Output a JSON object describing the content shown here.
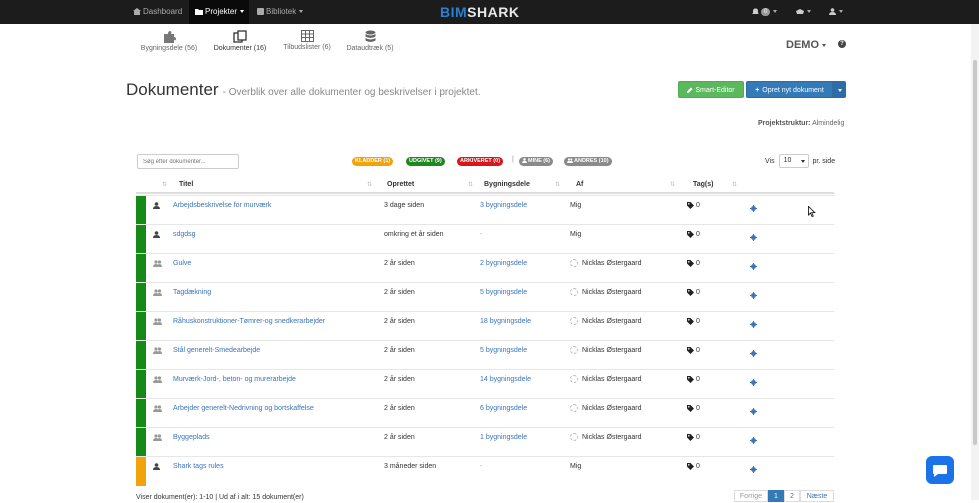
{
  "navbar": {
    "dashboard": "Dashboard",
    "projects": "Projekter",
    "library": "Bibliotek",
    "logo_a": "BIM",
    "logo_b": "SHARK",
    "notification_count": "0"
  },
  "subnav": {
    "tabs": [
      {
        "label": "Bygningsdele (56)",
        "icon": "puzzle-icon"
      },
      {
        "label": "Dokumenter (16)",
        "icon": "documents-icon"
      },
      {
        "label": "Tilbudslister (6)",
        "icon": "table-icon"
      },
      {
        "label": "Dataudtræk (5)",
        "icon": "database-icon"
      }
    ],
    "project_name": "DEMO",
    "help": "?"
  },
  "header": {
    "title": "Dokumenter",
    "subtitle": "- Overblik over alle dokumenter og beskrivelser i projektet.",
    "smart_editor": "Smart-Editor",
    "create_document": "Opret nyt dokument",
    "structure_label": "Projektstruktur:",
    "structure_value": "Almindelig"
  },
  "toolbar": {
    "search_placeholder": "Søg efter dokumenter...",
    "filters": [
      {
        "label": "KLADDER (1)",
        "color": "#f0a30a"
      },
      {
        "label": "UDGIVET (9)",
        "color": "#1e8a1e"
      },
      {
        "label": "ARKIVERET (0)",
        "color": "#d9161c"
      },
      {
        "label": "MINE (6)",
        "color": "#8a8a8a"
      },
      {
        "label": "ANDRES (10)",
        "color": "#8a8a8a"
      }
    ],
    "show_label": "Vis",
    "per_page_value": "10",
    "per_page_suffix": "pr. side"
  },
  "table": {
    "columns": [
      "Titel",
      "Oprettet",
      "Bygningsdele",
      "Af",
      "Tag(s)"
    ],
    "rows": [
      {
        "status": "#168a16",
        "owner": "person",
        "title": "Arbejdsbeskrivelse for murværk",
        "created": "3 dage siden",
        "parts": "3 bygningsdele",
        "by": "Mig",
        "tags": "0"
      },
      {
        "status": "#168a16",
        "owner": "person",
        "title": "sdgdsg",
        "created": "omkring et år siden",
        "parts": "-",
        "by": "Mig",
        "tags": "0"
      },
      {
        "status": "#168a16",
        "owner": "group",
        "title": "Gulve",
        "created": "2 år siden",
        "parts": "2 bygningsdele",
        "by": "Nicklas Østergaard",
        "tags": "0"
      },
      {
        "status": "#168a16",
        "owner": "group",
        "title": "Tagdækning",
        "created": "2 år siden",
        "parts": "5 bygningsdele",
        "by": "Nicklas Østergaard",
        "tags": "0"
      },
      {
        "status": "#168a16",
        "owner": "group",
        "title": "Råhuskonstruktioner-Tømrer-og snedkerarbejder",
        "created": "2 år siden",
        "parts": "18 bygningsdele",
        "by": "Nicklas Østergaard",
        "tags": "0"
      },
      {
        "status": "#168a16",
        "owner": "group",
        "title": "Stål generelt-Smedearbejde",
        "created": "2 år siden",
        "parts": "5 bygningsdele",
        "by": "Nicklas Østergaard",
        "tags": "0"
      },
      {
        "status": "#168a16",
        "owner": "group",
        "title": "Murværk-Jord-, beton- og murerarbejde",
        "created": "2 år siden",
        "parts": "14 bygningsdele",
        "by": "Nicklas Østergaard",
        "tags": "0"
      },
      {
        "status": "#168a16",
        "owner": "group",
        "title": "Arbejder generelt-Nedrivning og bortskaffelse",
        "created": "2 år siden",
        "parts": "6 bygningsdele",
        "by": "Nicklas Østergaard",
        "tags": "0"
      },
      {
        "status": "#168a16",
        "owner": "group",
        "title": "Byggeplads",
        "created": "2 år siden",
        "parts": "1 bygningsdele",
        "by": "Nicklas Østergaard",
        "tags": "0"
      },
      {
        "status": "#f0a30a",
        "owner": "person",
        "title": "Shark tags rules",
        "created": "3 måneder siden",
        "parts": "-",
        "by": "Mig",
        "tags": "0"
      }
    ]
  },
  "footer": {
    "count_text": "Viser dokument(er): 1-10 | Ud af i alt: 15 dokument(er)",
    "prev": "Forrige",
    "pages": [
      "1",
      "2"
    ],
    "next": "Næste"
  }
}
